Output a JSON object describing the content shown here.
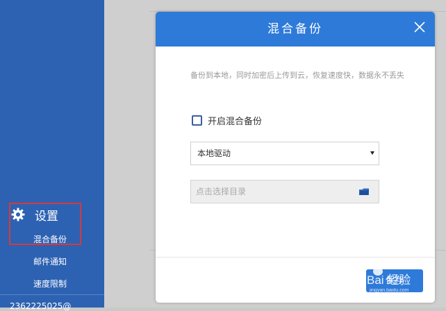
{
  "sidebar": {
    "settings_title": "设置",
    "items": [
      {
        "label": "混合备份"
      },
      {
        "label": "邮件通知"
      },
      {
        "label": "速度限制"
      }
    ],
    "bottom_text": "2362225025@",
    "icons": {
      "settings": "gear-icon"
    }
  },
  "dialog": {
    "title": "混合备份",
    "description": "备份到本地，同时加密后上传到云，恢复速度快，数据永不丢失",
    "checkbox_label": "开启混合备份",
    "checkbox_checked": false,
    "drive_select": {
      "selected": "本地驱动"
    },
    "directory_field": {
      "placeholder": "点击选择目录"
    },
    "save_label": "保存",
    "icons": {
      "close": "close-icon",
      "folder": "folder-icon",
      "dropdown": "dropdown-arrow-icon"
    }
  },
  "watermark": {
    "text": "Bai经验",
    "subtext": "jingyan.baidu.com"
  },
  "colors": {
    "sidebar": "#2d62b3",
    "header": "#2e7ad9",
    "highlight_box": "#d63a3a",
    "checkbox_border": "#3a5fa0"
  }
}
